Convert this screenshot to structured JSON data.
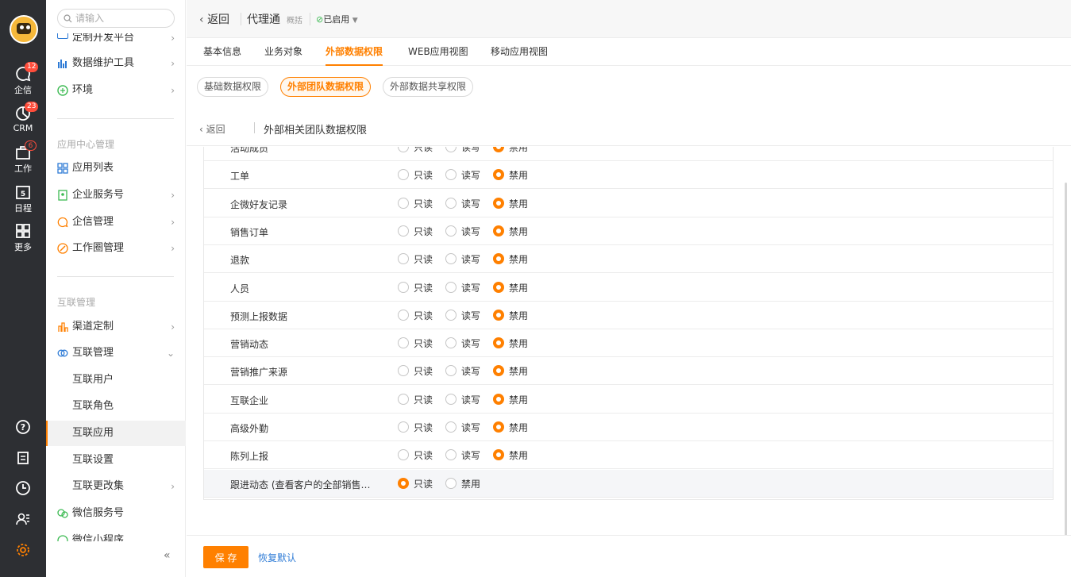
{
  "rail": {
    "items": [
      {
        "label": "企信",
        "badge": "12",
        "icon": "chat-bubble-icon"
      },
      {
        "label": "CRM",
        "badge": "23",
        "icon": "pie-chart-icon"
      },
      {
        "label": "工作",
        "badge": "6",
        "icon": "briefcase-icon"
      },
      {
        "label": "日程",
        "badge": "",
        "icon": "calendar-icon"
      },
      {
        "label": "更多",
        "badge": "",
        "icon": "grid-icon"
      }
    ]
  },
  "menu": {
    "search_placeholder": "请输入",
    "top_cut_item": "定制开发平台",
    "items_top": [
      {
        "label": "数据维护工具",
        "icon": "bar-chart-icon"
      },
      {
        "label": "环境",
        "icon": "environment-icon"
      }
    ],
    "group_app": "应用中心管理",
    "items_app": [
      {
        "label": "应用列表",
        "icon": "app-list-icon"
      },
      {
        "label": "企业服务号",
        "icon": "service-account-icon"
      },
      {
        "label": "企信管理",
        "icon": "chat-manage-icon"
      },
      {
        "label": "工作圈管理",
        "icon": "work-circle-icon"
      }
    ],
    "group_interconnect": "互联管理",
    "items_interconnect": [
      {
        "label": "渠道定制",
        "icon": "channel-icon"
      },
      {
        "label": "互联管理",
        "icon": "interconnect-icon"
      }
    ],
    "sub_items": [
      "互联用户",
      "互联角色",
      "互联应用",
      "互联设置",
      "互联更改集"
    ],
    "items_bottom": [
      {
        "label": "微信服务号",
        "icon": "wechat-icon"
      },
      {
        "label": "微信小程序",
        "icon": "miniprogram-icon"
      }
    ]
  },
  "header": {
    "back": "返回",
    "title": "代理通",
    "tag": "概括",
    "status": "已启用"
  },
  "tabs": [
    "基本信息",
    "业务对象",
    "外部数据权限",
    "WEB应用视图",
    "移动应用视图"
  ],
  "pills": [
    "基础数据权限",
    "外部团队数据权限",
    "外部数据共享权限"
  ],
  "subhead": {
    "back": "返回",
    "title": "外部相关团队数据权限"
  },
  "options": {
    "read": "只读",
    "readwrite": "读写",
    "disabled": "禁用"
  },
  "rows": [
    {
      "name": "活动成员",
      "selected": "disabled"
    },
    {
      "name": "工单",
      "selected": "disabled"
    },
    {
      "name": "企微好友记录",
      "selected": "disabled"
    },
    {
      "name": "销售订单",
      "selected": "disabled"
    },
    {
      "name": "退款",
      "selected": "disabled"
    },
    {
      "name": "人员",
      "selected": "disabled"
    },
    {
      "name": "预测上报数据",
      "selected": "disabled"
    },
    {
      "name": "营销动态",
      "selected": "disabled"
    },
    {
      "name": "营销推广来源",
      "selected": "disabled"
    },
    {
      "name": "互联企业",
      "selected": "disabled"
    },
    {
      "name": "高级外勤",
      "selected": "disabled"
    },
    {
      "name": "陈列上报",
      "selected": "disabled"
    },
    {
      "name": "跟进动态 (查看客户的全部销售…",
      "selected": "read",
      "two_options": true
    }
  ],
  "footer": {
    "save": "保 存",
    "reset": "恢复默认"
  },
  "colors": {
    "accent": "#ff8000",
    "rail": "#2d2f33",
    "link": "#2e7bd6",
    "badge": "#ff4d3b"
  }
}
